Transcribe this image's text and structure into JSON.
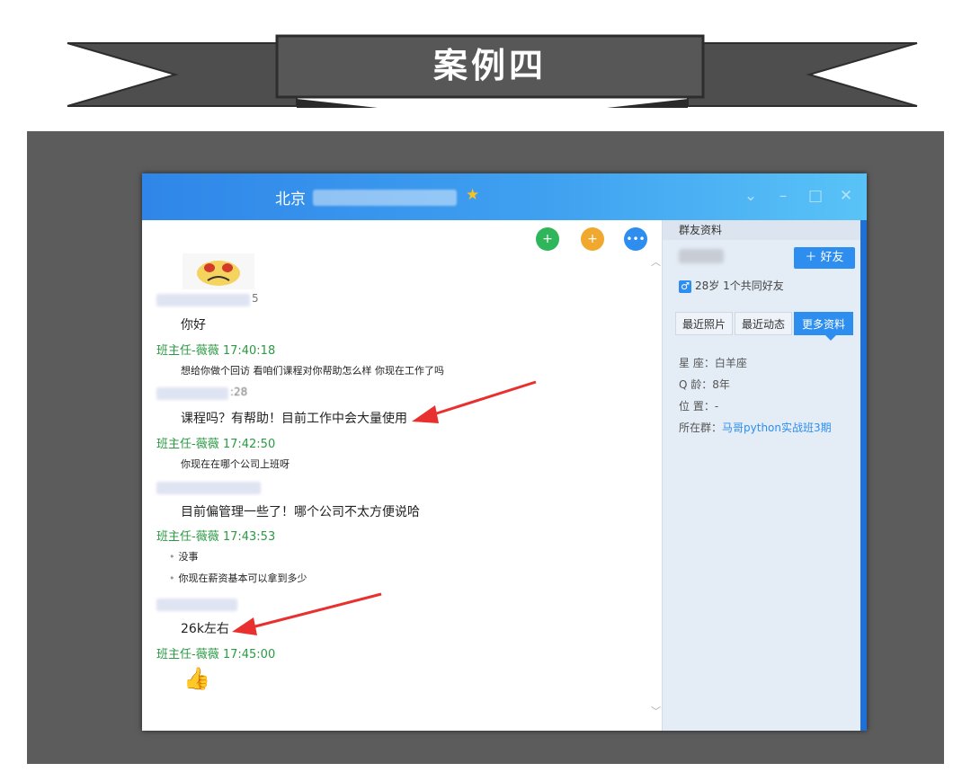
{
  "banner": {
    "title": "案例四"
  },
  "window": {
    "title_city": "北京",
    "star_icon": "star-icon",
    "controls": [
      "chevron-down-icon",
      "minimize-icon",
      "maximize-icon",
      "close-icon"
    ],
    "toolbar_icons": [
      "add-friend-icon",
      "invite-icon",
      "more-icon"
    ],
    "toolbar_colors": [
      "#2fb65a",
      "#f0a92e",
      "#2e8ef0"
    ]
  },
  "chat": {
    "messages": [
      {
        "kind": "sender-partial",
        "text": "5"
      },
      {
        "kind": "big",
        "text": "你好"
      },
      {
        "kind": "sender",
        "text": "班主任-薇薇  17:40:18"
      },
      {
        "kind": "small",
        "text": "想给你做个回访 看咱们课程对你帮助怎么样  你现在工作了吗"
      },
      {
        "kind": "sender-partial",
        "text": ":28"
      },
      {
        "kind": "big",
        "text": "课程吗？有帮助！目前工作中会大量使用"
      },
      {
        "kind": "sender",
        "text": "班主任-薇薇  17:42:50"
      },
      {
        "kind": "small",
        "text": "你现在在哪个公司上班呀"
      },
      {
        "kind": "big",
        "text": "目前偏管理一些了！哪个公司不太方便说哈"
      },
      {
        "kind": "sender",
        "text": "班主任-薇薇  17:43:53"
      },
      {
        "kind": "bullet",
        "text": "没事"
      },
      {
        "kind": "bullet",
        "text": "你现在薪资基本可以拿到多少"
      },
      {
        "kind": "big",
        "text": "26k左右"
      },
      {
        "kind": "sender",
        "text": "班主任-薇薇  17:45:00"
      }
    ],
    "thumb_icon": "thumbs-up-icon",
    "arrow_color": "#e8312f"
  },
  "side": {
    "header": "群友资料",
    "add_friend": "＋ 好友",
    "gender_icon": "male-icon",
    "gender_line": "28岁 1个共同好友",
    "tabs": [
      "最近照片",
      "最近动态",
      "更多资料"
    ],
    "active_tab": "更多资料",
    "info": {
      "zodiac": "星  座：白羊座",
      "q_age": "Q  龄：8年",
      "location": "位  置：-",
      "group_label": "所在群：",
      "group_name": "马哥python实战班3期"
    }
  }
}
